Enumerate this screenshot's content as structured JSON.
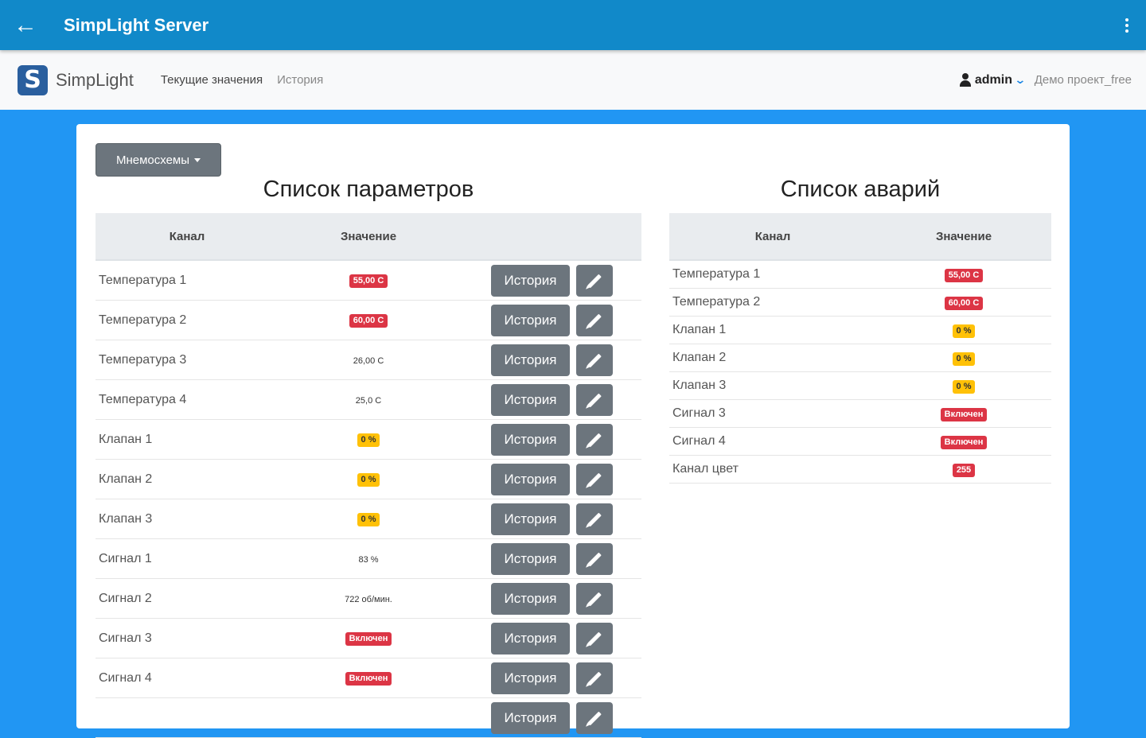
{
  "appbar": {
    "title": "SimpLight Server",
    "back_icon": "arrow-left-icon",
    "menu_icon": "more-vert-icon"
  },
  "navbar": {
    "brand": "SimpLight",
    "logo_letter": "S",
    "links": [
      "Текущие значения",
      "История"
    ],
    "user": "admin",
    "project": "Демо проект_free"
  },
  "mnemo_button": "Мнемосхемы",
  "params": {
    "title": "Список параметров",
    "headers": [
      "Канал",
      "Значение"
    ],
    "history_label": "История",
    "rows": [
      {
        "name": "Температура 1",
        "value": "55,00 С",
        "badge": "red"
      },
      {
        "name": "Температура 2",
        "value": "60,00 С",
        "badge": "red"
      },
      {
        "name": "Температура 3",
        "value": "26,00 С",
        "badge": "none"
      },
      {
        "name": "Температура 4",
        "value": "25,0 С",
        "badge": "none"
      },
      {
        "name": "Клапан 1",
        "value": "0 %",
        "badge": "yellow"
      },
      {
        "name": "Клапан 2",
        "value": "0 %",
        "badge": "yellow"
      },
      {
        "name": "Клапан 3",
        "value": "0 %",
        "badge": "yellow"
      },
      {
        "name": "Сигнал 1",
        "value": "83 %",
        "badge": "none"
      },
      {
        "name": "Сигнал 2",
        "value": "722 об/мин.",
        "badge": "none"
      },
      {
        "name": "Сигнал 3",
        "value": "Включен",
        "badge": "red"
      },
      {
        "name": "Сигнал 4",
        "value": "Включен",
        "badge": "red"
      },
      {
        "name": "",
        "value": "",
        "badge": "none"
      }
    ]
  },
  "alarms": {
    "title": "Список аварий",
    "headers": [
      "Канал",
      "Значение"
    ],
    "rows": [
      {
        "name": "Температура 1",
        "value": "55,00 С",
        "badge": "red"
      },
      {
        "name": "Температура 2",
        "value": "60,00 С",
        "badge": "red"
      },
      {
        "name": "Клапан 1",
        "value": "0 %",
        "badge": "yellow"
      },
      {
        "name": "Клапан 2",
        "value": "0 %",
        "badge": "yellow"
      },
      {
        "name": "Клапан 3",
        "value": "0 %",
        "badge": "yellow"
      },
      {
        "name": "Сигнал 3",
        "value": "Включен",
        "badge": "red"
      },
      {
        "name": "Сигнал 4",
        "value": "Включен",
        "badge": "red"
      },
      {
        "name": "Канал цвет",
        "value": "255",
        "badge": "red"
      }
    ]
  },
  "colors": {
    "appbar": "#1189c9",
    "background": "#2196f3",
    "danger": "#dc3545",
    "warning": "#ffc107",
    "secondary": "#6c757d"
  }
}
